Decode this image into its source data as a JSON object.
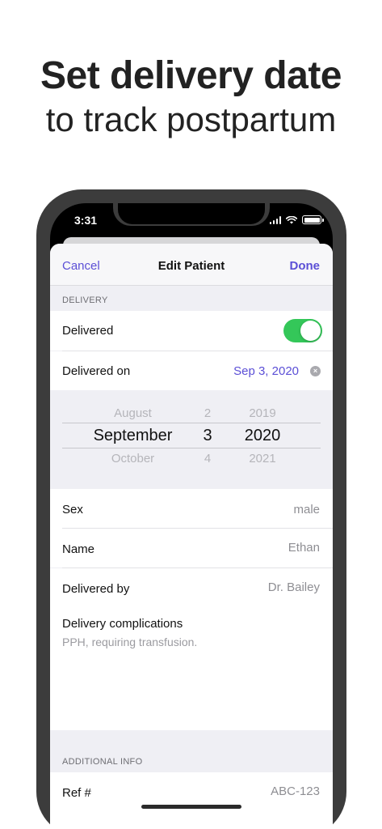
{
  "headline": {
    "line1": "Set delivery date",
    "line2": "to track postpartum"
  },
  "status_bar": {
    "time": "3:31"
  },
  "nav": {
    "cancel": "Cancel",
    "title": "Edit Patient",
    "done": "Done"
  },
  "delivery_section": {
    "header": "DELIVERY",
    "delivered_label": "Delivered",
    "delivered_on_label": "Delivered on",
    "delivered_on_value": "Sep 3, 2020"
  },
  "picker": {
    "months": [
      "August",
      "September",
      "October"
    ],
    "days": [
      "2",
      "3",
      "4"
    ],
    "years": [
      "2019",
      "2020",
      "2021"
    ]
  },
  "fields": {
    "sex_label": "Sex",
    "sex_value": "male",
    "name_label": "Name",
    "name_value": "Ethan",
    "delivered_by_label": "Delivered by",
    "delivered_by_value": "Dr. Bailey",
    "complications_label": "Delivery complications",
    "complications_value": "PPH, requiring transfusion."
  },
  "additional_section": {
    "header": "ADDITIONAL INFO",
    "ref_label": "Ref #",
    "ref_value": "ABC-123"
  },
  "colors": {
    "accent": "#5b4fd6",
    "toggle_on": "#34c759"
  }
}
